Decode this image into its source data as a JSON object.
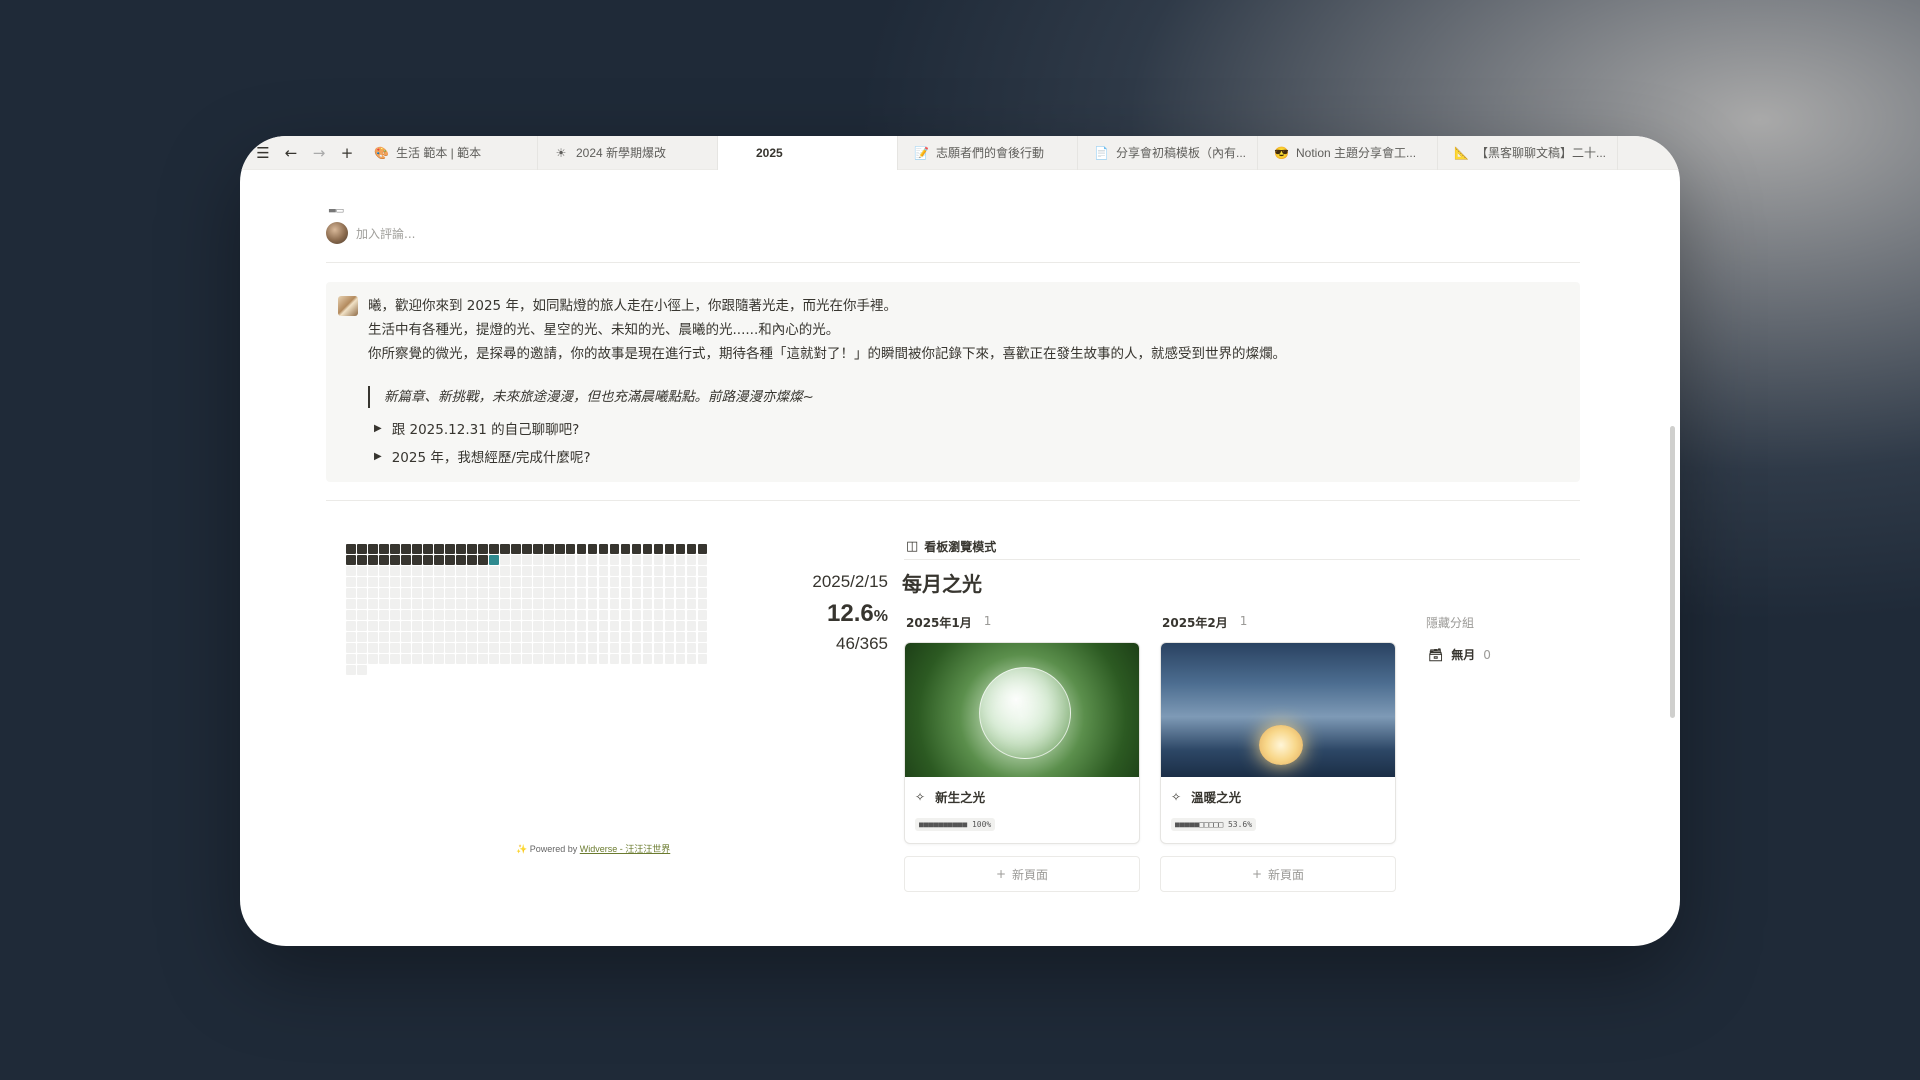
{
  "tabs": [
    {
      "icon": "🎨",
      "label": "生活 範本 | 範本",
      "active": false
    },
    {
      "icon": "☀",
      "label": "2024 新學期爆改",
      "active": false
    },
    {
      "icon": "",
      "label": "2025",
      "active": true
    },
    {
      "icon": "📝",
      "label": "志願者們的會後行動",
      "active": false
    },
    {
      "icon": "📄",
      "label": "分享會初稿模板（內有...",
      "active": false
    },
    {
      "icon": "😎",
      "label": "Notion 主題分享會工...",
      "active": false
    },
    {
      "icon": "📐",
      "label": "【黑客聊聊文稿】二十...",
      "active": false
    }
  ],
  "comment": {
    "placeholder": "加入評論..."
  },
  "callout": {
    "line1": "曦，歡迎你來到 2025 年，如同點燈的旅人走在小徑上，你跟隨著光走，而光在你手裡。",
    "line2": "生活中有各種光，提燈的光、星空的光、未知的光、晨曦的光......和內心的光。",
    "line3": "你所察覺的微光，是探尋的邀請，你的故事是現在進行式，期待各種「這就對了！」的瞬間被你記錄下來，喜歡正在發生故事的人，就感受到世界的燦爛。",
    "quote": "新篇章、新挑戰，未來旅途漫漫，但也充滿晨曦點點。前路漫漫亦燦燦~",
    "toggle1": "跟 2025.12.31 的自己聊聊吧?",
    "toggle2": "2025 年，我想經歷/完成什麼呢?"
  },
  "progress": {
    "date": "2025/2/15",
    "percent": "12.6",
    "percent_unit": "%",
    "count": "46/365",
    "days_done": 46,
    "days_total": 365,
    "powered_prefix": "✨ Powered by ",
    "powered_link": "Widverse - 汪汪汪世界"
  },
  "board": {
    "view_label": "看板瀏覽模式",
    "title": "每月之光",
    "columns": [
      {
        "name": "2025年1月",
        "count": "1",
        "card_title": "新生之光",
        "card_progress": "■■■■■■■■■■ 100%",
        "new_page": "新頁面"
      },
      {
        "name": "2025年2月",
        "count": "1",
        "card_title": "溫暖之光",
        "card_progress": "■■■■■□□□□□ 53.6%",
        "new_page": "新頁面"
      }
    ],
    "hidden_groups_label": "隱藏分組",
    "no_month_label": "無月",
    "no_month_count": "0"
  },
  "colors": {
    "done_dot": "#37352f",
    "today_dot": "#2f8a8f",
    "empty_dot": "#f0f0ef"
  }
}
